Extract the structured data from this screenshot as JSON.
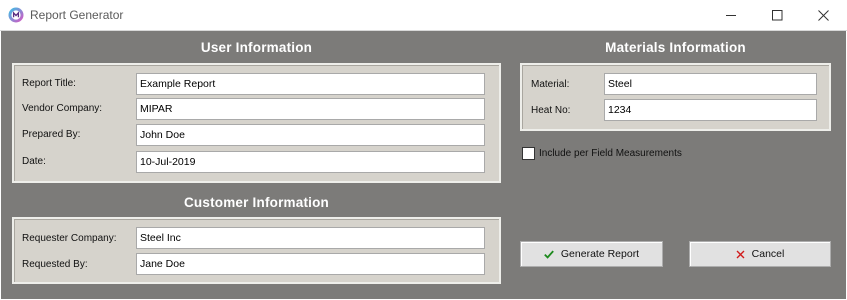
{
  "window": {
    "title": "Report Generator",
    "app_icon": "mipar-app-icon"
  },
  "user_information": {
    "title": "User Information",
    "fields": [
      {
        "label": "Report Title:",
        "value": "Example Report"
      },
      {
        "label": "Vendor Company:",
        "value": "MIPAR"
      },
      {
        "label": "Prepared By:",
        "value": "John Doe"
      },
      {
        "label": "Date:",
        "value": "10-Jul-2019"
      }
    ]
  },
  "customer_information": {
    "title": "Customer Information",
    "fields": [
      {
        "label": "Requester Company:",
        "value": "Steel Inc"
      },
      {
        "label": "Requested By:",
        "value": "Jane Doe"
      }
    ]
  },
  "materials_information": {
    "title": "Materials Information",
    "fields": [
      {
        "label": "Material:",
        "value": "Steel"
      },
      {
        "label": "Heat No:",
        "value": "1234"
      }
    ],
    "per_field_checkbox": {
      "label": "Include per Field Measurements",
      "checked": false
    }
  },
  "buttons": {
    "generate": {
      "label": "Generate Report",
      "icon": "checkmark-icon",
      "icon_color": "#1e8a1e"
    },
    "cancel": {
      "label": "Cancel",
      "icon": "x-icon",
      "icon_color": "#d11b1b"
    }
  },
  "colors": {
    "background": "#7c7b79",
    "panel": "#d6d3cc",
    "section_title": "#ffffff"
  }
}
